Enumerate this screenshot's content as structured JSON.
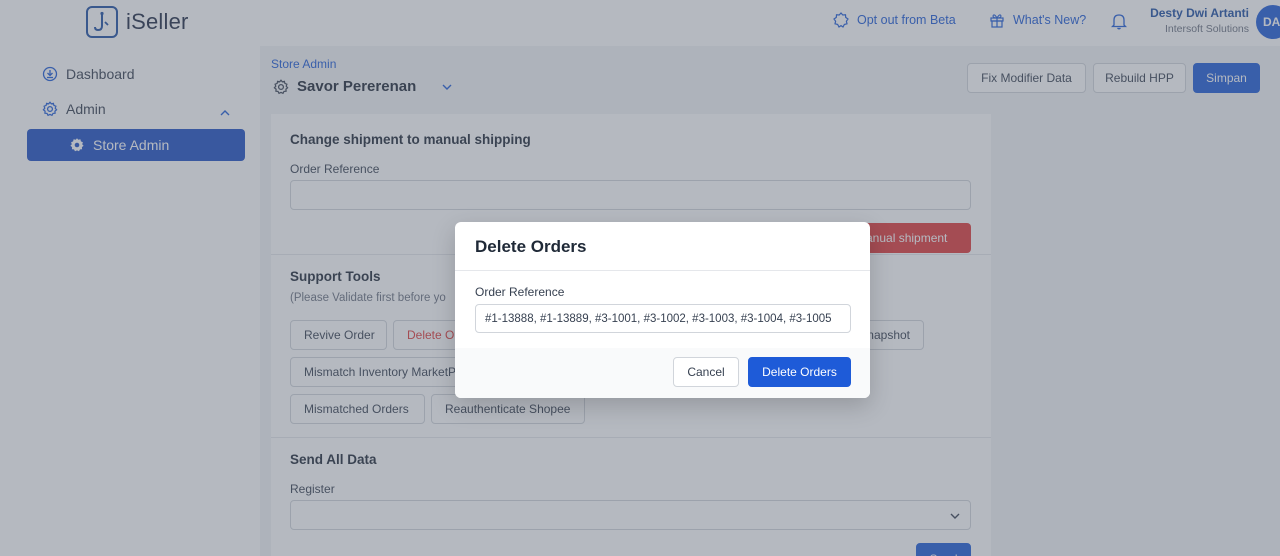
{
  "app": {
    "name": "iSeller"
  },
  "header": {
    "opt_out_label": "Opt out from Beta",
    "whats_new_label": "What's New?",
    "user_name": "Desty Dwi Artanti",
    "user_org": "Intersoft Solutions",
    "avatar_initials": "DA"
  },
  "sidebar": {
    "items": [
      {
        "label": "Dashboard",
        "icon": "dashboard-icon"
      },
      {
        "label": "Admin",
        "icon": "gear-icon"
      },
      {
        "label": "Store Admin",
        "icon": "gear-icon",
        "active": true
      }
    ]
  },
  "page": {
    "breadcrumb": "Store Admin",
    "store_name": "Savor Pererenan",
    "actions": {
      "fix_modifier": "Fix Modifier Data",
      "rebuild_hpp": "Rebuild HPP",
      "save": "Simpan"
    }
  },
  "sections": {
    "manual_shipping": {
      "title": "Change shipment to manual shipping",
      "field_label": "Order Reference",
      "button_label": "anual shipment"
    },
    "support_tools": {
      "title": "Support Tools",
      "note": "(Please Validate first before yo",
      "buttons": [
        "Revive Order",
        "Delete O",
        "napshot",
        "Mismatch Inventory MarketP",
        "Mismatched Orders",
        "Reauthenticate Shopee"
      ]
    },
    "send_all_data": {
      "title": "Send All Data",
      "field_label": "Register",
      "button_label": "Send"
    }
  },
  "modal": {
    "title": "Delete Orders",
    "field_label": "Order Reference",
    "field_value": "#1-13888, #1-13889, #3-1001, #3-1002, #3-1003, #3-1004, #3-1005",
    "cancel_label": "Cancel",
    "confirm_label": "Delete Orders"
  },
  "colors": {
    "primary": "#1e5bd8",
    "danger": "#e03a3a",
    "sidebar_active": "#1e4fc3"
  }
}
